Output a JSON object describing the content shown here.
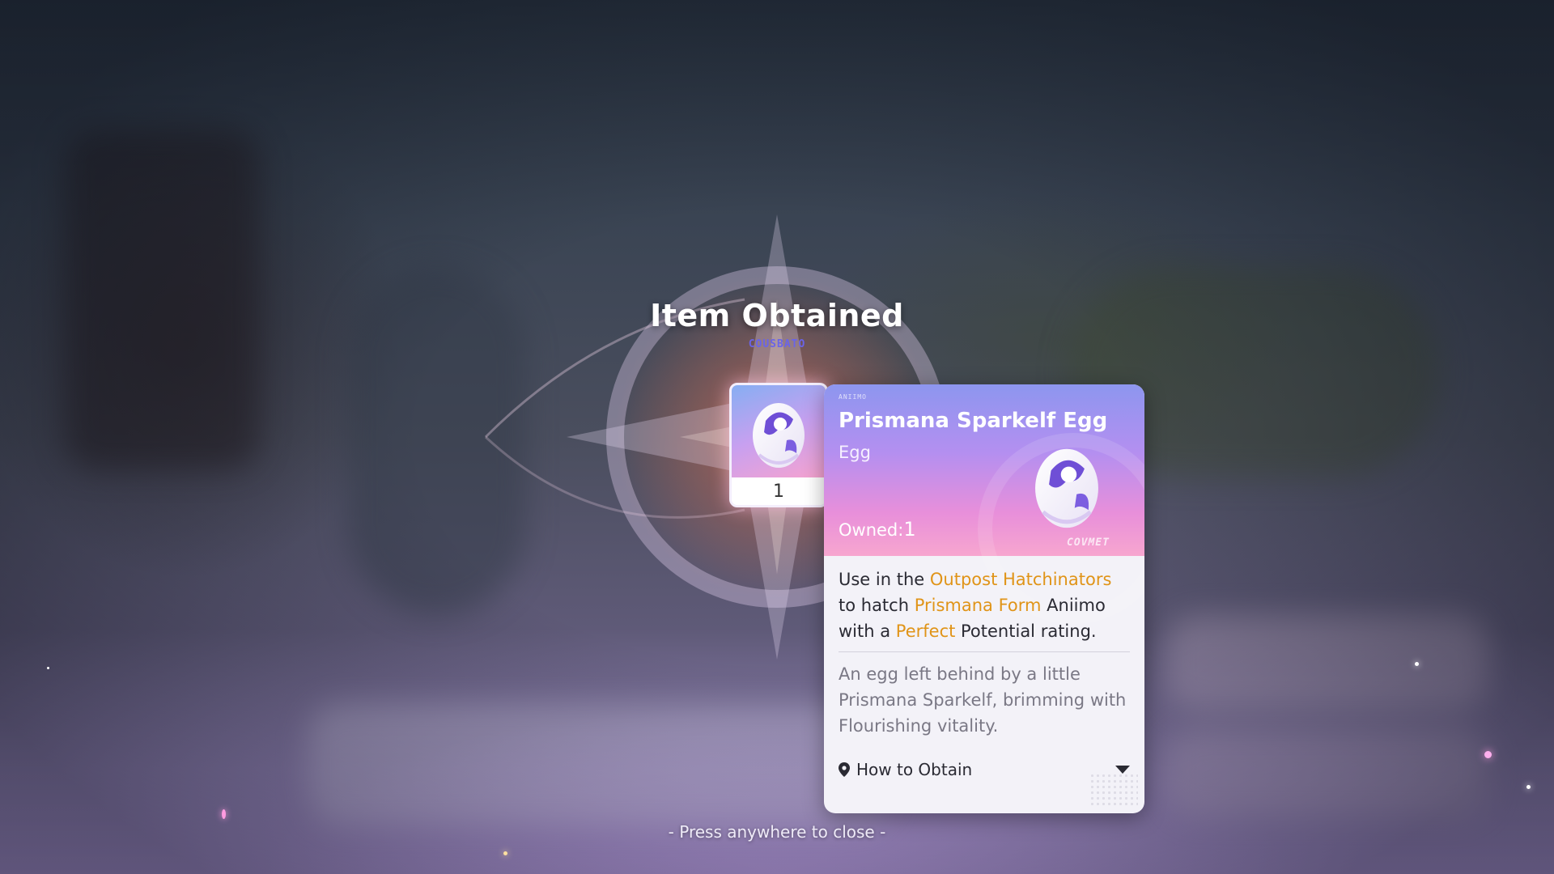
{
  "popup": {
    "title": "Item Obtained",
    "subtitle": "COUSBATO",
    "close_hint": "- Press anywhere to close -"
  },
  "item_slot": {
    "count": "1",
    "icon": "prismana-egg-icon"
  },
  "item_card": {
    "tag": "ANIIMO",
    "name": "Prismana Sparkelf Egg",
    "type": "Egg",
    "owned_label": "Owned:",
    "owned_value": "1",
    "mark": "COVMET",
    "description": {
      "p1": "Use in the ",
      "h1": "Outpost Hatchinators",
      "p2": " to hatch ",
      "h2": "Prismana Form",
      "p3": " Aniimo with a ",
      "h3": "Perfect",
      "p4": " Potential rating."
    },
    "flavor": "An egg left behind by a little Prismana Sparkelf, brimming with Flourishing vitality.",
    "how_to_obtain": "How to Obtain"
  },
  "colors": {
    "highlight": "#e09418",
    "card_header_top": "#8d96ef",
    "card_header_bottom": "#f7a6cf"
  }
}
